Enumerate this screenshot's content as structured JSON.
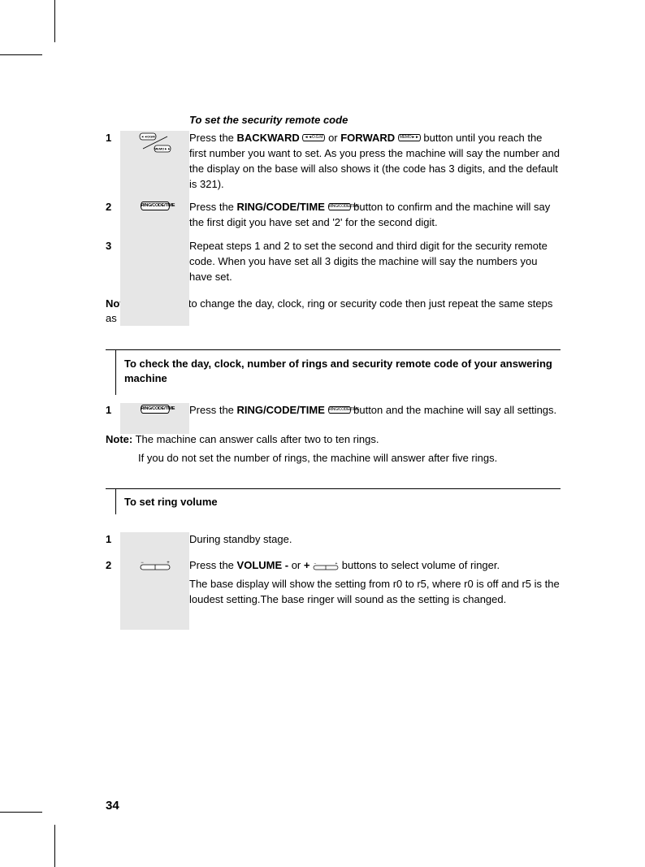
{
  "page_number": "34",
  "section1": {
    "title": "To set the security remote code",
    "steps": [
      {
        "num": "1",
        "text_before": "Press the ",
        "b1": "BACKWARD",
        "text_mid1": " or ",
        "b2": "FORWARD",
        "text_after": " button until you reach the first number you want to set.  As you press the machine will say the number and the display on the base will also shows it (the code has 3 digits, and the default is 321).",
        "icon1_label": "◄◄O.G.M.",
        "icon2_label": "MEMO►►"
      },
      {
        "num": "2",
        "text_before": "Press the ",
        "b1": "RING/CODE/TIME",
        "text_after": " button to confirm and the machine will say the first digit you have set and '2' for the second digit.",
        "icon_label": "RING/CODE/TIME"
      },
      {
        "num": "3",
        "text": "Repeat steps 1 and 2 to set the second and third digit for the security remote code.  When you have set all 3 digits the machine will say the numbers you have set."
      }
    ],
    "note": {
      "label": "Note:",
      "text": " If you wish to change the day, clock, ring or security code then just repeat the same steps as above."
    }
  },
  "section2": {
    "title": "To check the day, clock, number of rings and security remote code of your answering machine",
    "steps": [
      {
        "num": "1",
        "text_before": "Press the ",
        "b1": "RING/CODE/TIME",
        "text_after": " button and the machine will say all settings.",
        "icon_label": "RING/CODE/TIME"
      }
    ],
    "note": {
      "label": "Note:",
      "text1": " The machine can answer calls after two to ten rings.",
      "text2": "If you do not set the number of rings, the machine will answer after five rings."
    }
  },
  "section3": {
    "title": "To set ring volume",
    "steps": [
      {
        "num": "1",
        "text": "During standby stage."
      },
      {
        "num": "2",
        "text_before": "Press the ",
        "b1": "VOLUME -",
        "text_mid1": " or ",
        "b2": "+",
        "text_after": "  buttons to select volume of ringer.",
        "text_line2": "The base display will show the setting from r0 to r5, where r0 is off and r5 is the loudest setting.The base ringer will sound as the setting is changed."
      }
    ]
  },
  "icon_labels": {
    "backward": "◄◄O.G.M.",
    "forward": "MEMO►►",
    "ring_code_time": "RING/CODE/TIME"
  }
}
